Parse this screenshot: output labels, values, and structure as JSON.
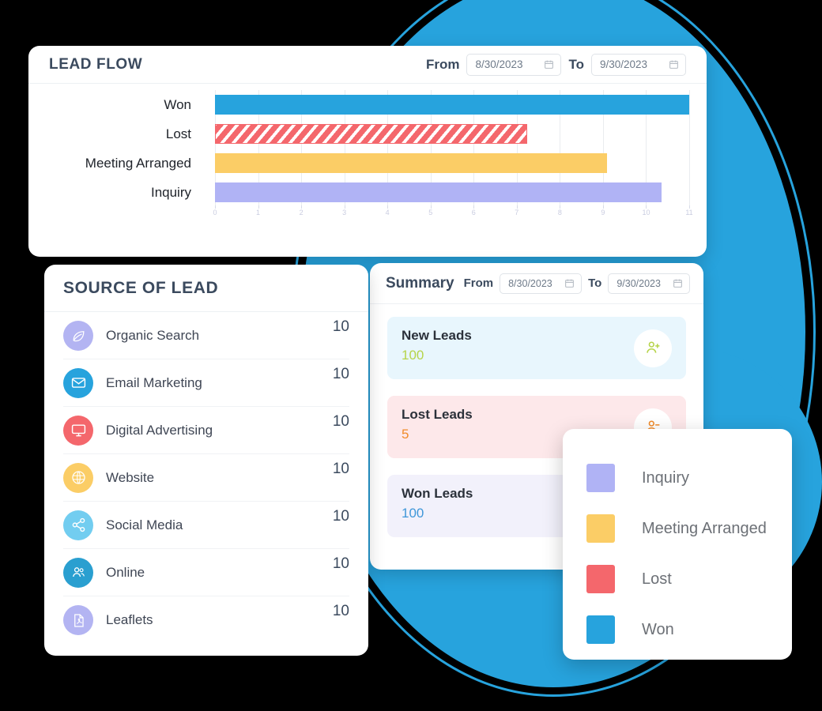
{
  "lead_flow": {
    "title": "LEAD FLOW",
    "from_label": "From",
    "to_label": "To",
    "from_value": "8/30/2023",
    "to_value": "9/30/2023",
    "calendar_icon": "calendar-icon"
  },
  "chart_data": {
    "type": "bar",
    "orientation": "horizontal",
    "title": "LEAD FLOW",
    "categories": [
      "Won",
      "Lost",
      "Meeting Arranged",
      "Inquiry"
    ],
    "values": [
      11,
      7.25,
      9.1,
      10.35
    ],
    "colors": [
      "#27a3dd",
      "#f4676c",
      "#fbcd66",
      "#b0b3f5"
    ],
    "patterns": [
      "solid",
      "diagonal-stripes",
      "solid",
      "solid"
    ],
    "xlabel": "",
    "ylabel": "",
    "xlim": [
      0,
      11
    ],
    "xticks": [
      0,
      1,
      2,
      3,
      4,
      5,
      6,
      7,
      8,
      9,
      10,
      11
    ],
    "grid": true,
    "legend": [
      "Inquiry",
      "Meeting Arranged",
      "Lost",
      "Won"
    ]
  },
  "source_of_lead": {
    "title": "SOURCE OF LEAD",
    "items": [
      {
        "label": "Organic Search",
        "count": "10",
        "icon": "leaf-icon",
        "color": "#b3b4f2"
      },
      {
        "label": "Email Marketing",
        "count": "10",
        "icon": "envelope-icon",
        "color": "#27a3dd"
      },
      {
        "label": "Digital Advertising",
        "count": "10",
        "icon": "monitor-icon",
        "color": "#f4676c"
      },
      {
        "label": "Website",
        "count": "10",
        "icon": "globe-icon",
        "color": "#fbcd66"
      },
      {
        "label": "Social Media",
        "count": "10",
        "icon": "share-icon",
        "color": "#72cdf0"
      },
      {
        "label": "Online",
        "count": "10",
        "icon": "people-icon",
        "color": "#2a9fd0"
      },
      {
        "label": "Leaflets",
        "count": "10",
        "icon": "pdf-file-icon",
        "color": "#b3b4f2"
      }
    ]
  },
  "summary": {
    "title": "Summary",
    "from_label": "From",
    "to_label": "To",
    "from_value": "8/30/2023",
    "to_value": "9/30/2023",
    "cards": [
      {
        "label": "New Leads",
        "value": "100",
        "icon": "user-plus-icon",
        "bg": "#e8f6fd",
        "value_color": "#b6d44a"
      },
      {
        "label": "Lost Leads",
        "value": "5",
        "icon": "user-minus-icon",
        "bg": "#fde8ea",
        "value_color": "#f08b2a"
      },
      {
        "label": "Won Leads",
        "value": "100",
        "icon": "user-check-icon",
        "bg": "#f2f1fb",
        "value_color": "#3f97d9"
      }
    ]
  },
  "legend": {
    "items": [
      {
        "label": "Inquiry",
        "color": "#b0b3f5"
      },
      {
        "label": "Meeting Arranged",
        "color": "#fbcd66"
      },
      {
        "label": "Lost",
        "color": "#f4676c"
      },
      {
        "label": "Won",
        "color": "#27a3dd"
      }
    ]
  },
  "theme": {
    "accent_blue": "#27a3dd",
    "background": "#000000",
    "text_dark": "#3b4a5e"
  }
}
